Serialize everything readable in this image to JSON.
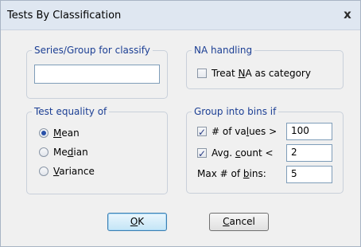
{
  "window": {
    "title": "Tests By Classification",
    "close_glyph": "x"
  },
  "series_group": {
    "legend": "Series/Group for classify",
    "value": ""
  },
  "na_handling": {
    "legend": "NA handling",
    "treat_na": {
      "label_pre": "Treat ",
      "label_u": "N",
      "label_post": "A as category",
      "checked": false
    }
  },
  "test_equality": {
    "legend": "Test equality of",
    "options": [
      {
        "pre": "",
        "u": "M",
        "post": "ean",
        "selected": true
      },
      {
        "pre": "Me",
        "u": "d",
        "post": "ian",
        "selected": false
      },
      {
        "pre": "",
        "u": "V",
        "post": "ariance",
        "selected": false
      }
    ]
  },
  "bins": {
    "legend": "Group into bins if",
    "num_values": {
      "pre": "# of va",
      "u": "l",
      "post": "ues >",
      "checked": true,
      "value": "100"
    },
    "avg_count": {
      "pre": "Avg. ",
      "u": "c",
      "post": "ount <",
      "checked": true,
      "value": "2"
    },
    "max_bins": {
      "pre": "Max # of ",
      "u": "b",
      "post": "ins:",
      "value": "5"
    }
  },
  "buttons": {
    "ok": {
      "u": "O",
      "post": "K"
    },
    "cancel": {
      "u": "C",
      "post": "ancel"
    }
  },
  "icons": {
    "checkmark": "✓",
    "close": "x"
  }
}
